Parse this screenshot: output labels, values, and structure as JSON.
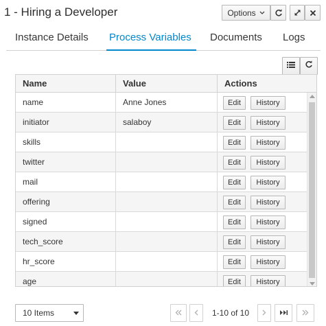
{
  "header": {
    "title": "1 - Hiring a Developer",
    "options_label": "Options",
    "icons": [
      "refresh-icon",
      "expand-icon",
      "close-icon"
    ]
  },
  "tabs": [
    {
      "label": "Instance Details",
      "active": false
    },
    {
      "label": "Process Variables",
      "active": true
    },
    {
      "label": "Documents",
      "active": false
    },
    {
      "label": "Logs",
      "active": false
    }
  ],
  "toolbar": {
    "icons": [
      "column-list-icon",
      "refresh-icon"
    ]
  },
  "table": {
    "columns": [
      "Name",
      "Value",
      "Actions"
    ],
    "edit_label": "Edit",
    "history_label": "History",
    "rows": [
      {
        "name": "name",
        "value": "Anne Jones"
      },
      {
        "name": "initiator",
        "value": "salaboy"
      },
      {
        "name": "skills",
        "value": ""
      },
      {
        "name": "twitter",
        "value": ""
      },
      {
        "name": "mail",
        "value": ""
      },
      {
        "name": "offering",
        "value": ""
      },
      {
        "name": "signed",
        "value": ""
      },
      {
        "name": "tech_score",
        "value": ""
      },
      {
        "name": "hr_score",
        "value": ""
      },
      {
        "name": "age",
        "value": ""
      }
    ]
  },
  "pagination": {
    "page_size": "10 Items",
    "info": "1-10 of 10",
    "icons": [
      "first-page-icon",
      "prev-page-icon",
      "next-page-icon",
      "last-page-icon",
      "end-icon"
    ]
  },
  "colors": {
    "accent": "#0088ce",
    "border": "#d1d1d1",
    "row_alt": "#f5f5f5"
  }
}
